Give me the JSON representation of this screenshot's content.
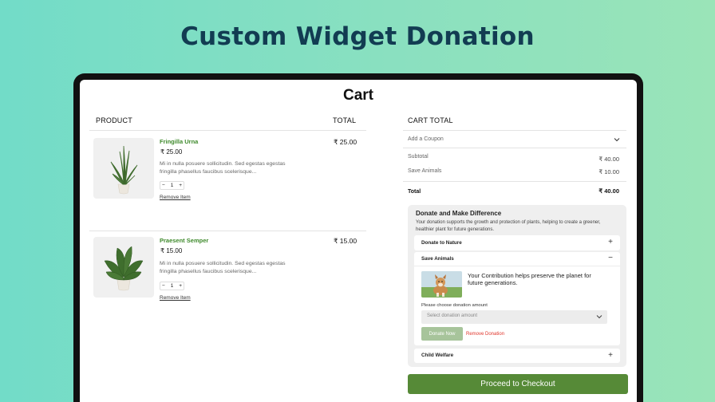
{
  "banner": {
    "title": "Custom Widget Donation"
  },
  "cart": {
    "title": "Cart",
    "headers": {
      "product": "PRODUCT",
      "total": "TOTAL"
    },
    "items": [
      {
        "name": "Fringilla Urna",
        "price": "₹ 25.00",
        "description_line1": "Mi in nulla posuere sollicitudin. Sed egestas egestas",
        "description_line2": "fringilla phasellus faucibus scelerisque...",
        "qty": "1",
        "minus": "−",
        "plus": "+",
        "remove": "Remove Item",
        "total": "₹ 25.00"
      },
      {
        "name": "Praesent Semper",
        "price": "₹ 15.00",
        "description_line1": "Mi in nulla posuere sollicitudin. Sed egestas egestas",
        "description_line2": "fringilla phasellus faucibus scelerisque...",
        "qty": "1",
        "minus": "−",
        "plus": "+",
        "remove": "Remove Item",
        "total": "₹ 15.00"
      }
    ]
  },
  "summary": {
    "title": "CART TOTAL",
    "coupon": "Add a Coupon",
    "subtotal_label": "Subtotal",
    "subtotal_value": "₹ 40.00",
    "save_animals_label": "Save Animals",
    "save_animals_value": "₹ 10.00",
    "total_label": "Total",
    "total_value": "₹ 40.00"
  },
  "donation": {
    "title": "Donate and Make Difference",
    "description_line1": "Your donation supports the growth and protection of plants, helping to create a greener,",
    "description_line2": "healthier plant for future generations.",
    "options": [
      {
        "label": "Donate to Nature",
        "sign": "+"
      },
      {
        "label": "Save Animals",
        "sign": "−"
      },
      {
        "label": "Child Welfare",
        "sign": "+"
      }
    ],
    "expanded": {
      "message_line1": "Your Contribution helps preserve the planet for",
      "message_line2": "future generations.",
      "amount_label": "Please choose donation amount",
      "select_placeholder": "Select donation amount",
      "donate_button": "Donate Now",
      "remove_link": "Remove Donation"
    }
  },
  "checkout": {
    "label": "Proceed to Checkout"
  },
  "colors": {
    "accent_green": "#568a37",
    "product_name_green": "#3f8a2c",
    "remove_red": "#e0362c",
    "headline_navy": "#123c52"
  }
}
